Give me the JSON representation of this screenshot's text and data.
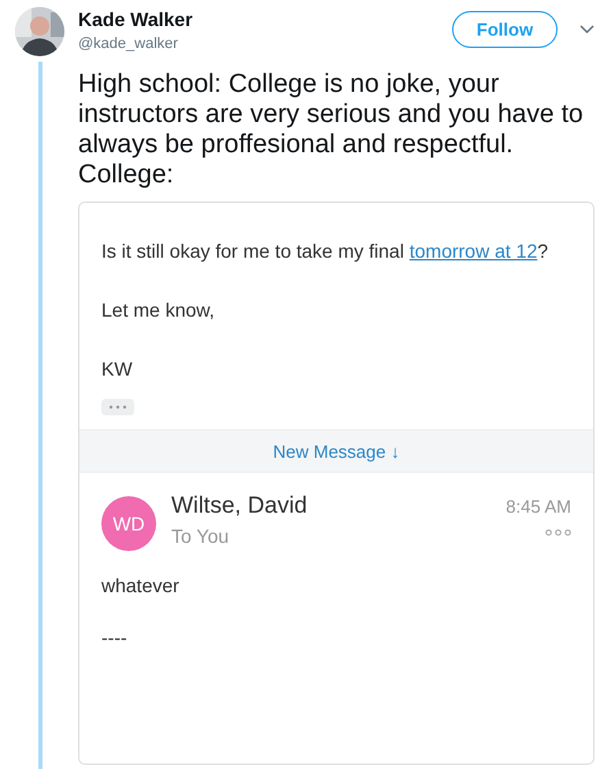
{
  "tweet": {
    "author": {
      "name": "Kade Walker",
      "handle": "@kade_walker"
    },
    "follow_button": "Follow",
    "text_lines": [
      "High school: College is no joke, your instructors are very serious and you have to always be proffesional and respectful.",
      "College:"
    ],
    "email": {
      "question": {
        "before": "Is it still okay for me to take my final ",
        "link": "tomorrow at 12",
        "after": "?"
      },
      "closing": "Let me know,",
      "signature": "KW",
      "new_message_bar": "New Message ↓",
      "reply": {
        "initials": "WD",
        "color": "#f06bb0",
        "sender": "Wiltse, David",
        "recipient": "To You",
        "time": "8:45 AM",
        "body": "whatever",
        "trailer": "----"
      }
    }
  }
}
